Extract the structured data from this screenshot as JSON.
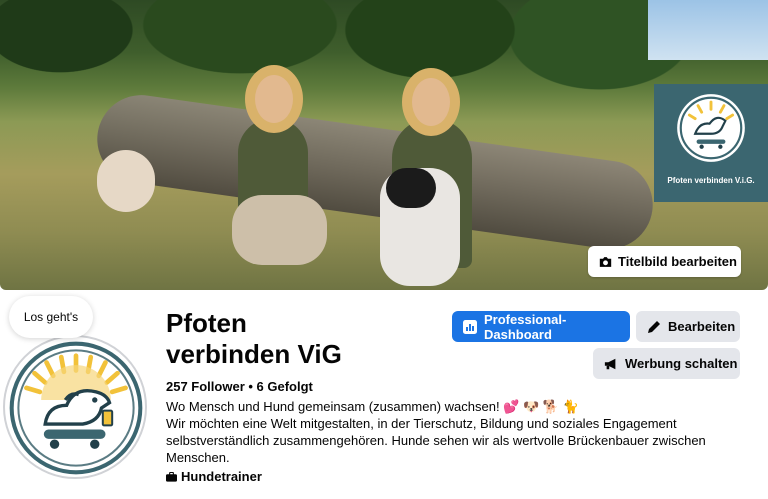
{
  "cover": {
    "logo_text": "Pfoten verbinden V.i.G.",
    "edit_button": "Titelbild bearbeiten"
  },
  "bubble": {
    "text": "Los geht's"
  },
  "profile": {
    "name_line1": "Pfoten",
    "name_line2": "verbinden ViG",
    "stats": "257 Follower • 6 Gefolgt",
    "bio": [
      "Wo Mensch und Hund gemeinsam (zusammen) wachsen! 💕 🐶 🐕 🐈",
      "Wir möchten eine Welt mitgestalten, in der Tierschutz, Bildung und soziales Engagement",
      "selbstverständlich zusammengehören. Hunde sehen wir als wertvolle Brückenbauer zwischen",
      "Menschen."
    ],
    "category": "Hundetrainer"
  },
  "actions": {
    "dashboard": "Professional-Dashboard",
    "edit": "Bearbeiten",
    "ads": "Werbung schalten"
  },
  "colors": {
    "primary": "#1b74e4",
    "secondary_button": "#e4e6eb",
    "logo_bg": "#3b6670"
  },
  "icons": {
    "camera": "camera-icon",
    "dashboard": "dashboard-icon",
    "pencil": "pencil-icon",
    "megaphone": "megaphone-icon",
    "briefcase": "briefcase-icon"
  }
}
